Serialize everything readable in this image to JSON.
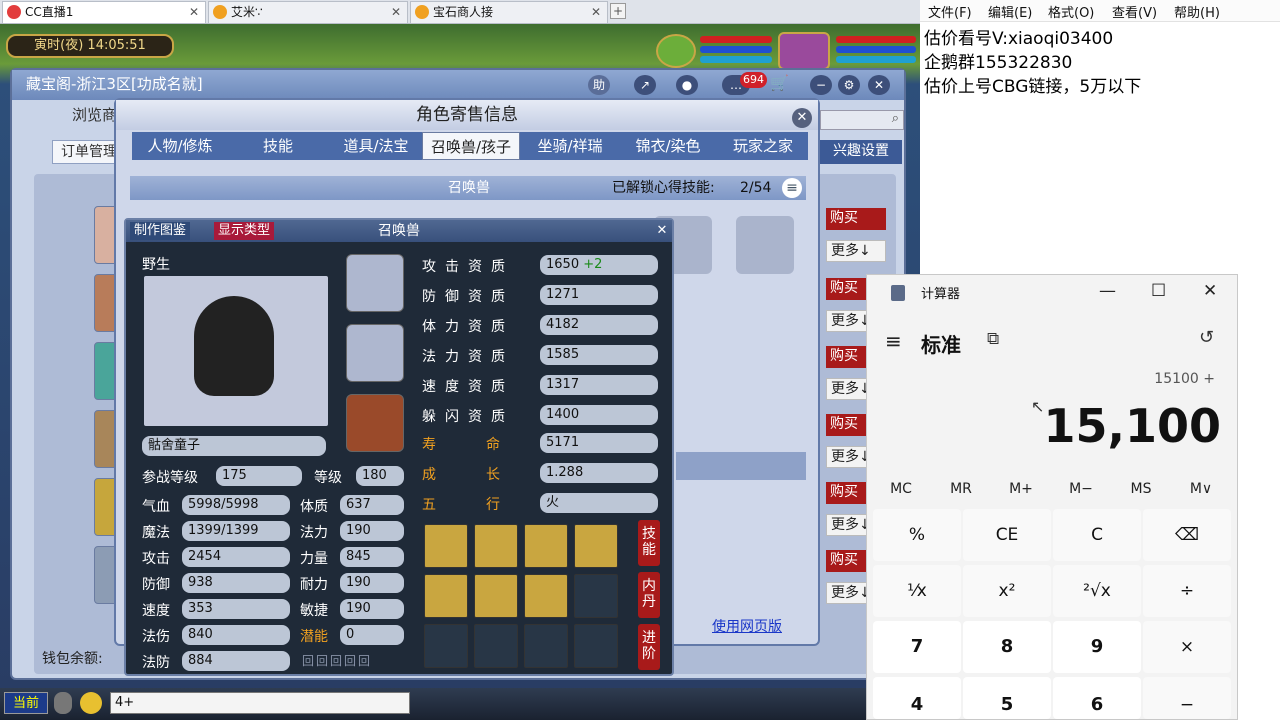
{
  "browser": {
    "tabs": [
      {
        "label": "CC直播1"
      },
      {
        "label": "艾米∵"
      },
      {
        "label": "宝石商人接"
      }
    ],
    "new_tab": "+"
  },
  "game": {
    "time": "寅时(夜)  14:05:51",
    "main_window": {
      "title": "藏宝阁-浙江3区[功成名就]",
      "help": "助",
      "badge": "694",
      "browse": "浏览商",
      "order": "订单管理",
      "hobby": "兴趣设置",
      "row_buy": "购买",
      "row_more": "更多↓",
      "wallet": "钱包余额:",
      "web_version": "使用网页版"
    },
    "role_dialog": {
      "title": "角色寄售信息",
      "tabs": [
        "人物/修炼",
        "技能",
        "道具/法宝",
        "召唤兽/孩子",
        "坐骑/祥瑞",
        "锦衣/染色",
        "玩家之家"
      ],
      "summon_header": "召唤兽",
      "unlock_label": "已解锁心得技能:",
      "unlock_value": "2/54"
    },
    "pet_card": {
      "chip_guide": "制作图鉴",
      "chip_type": "显示类型",
      "title": "召唤兽",
      "wild": "野生",
      "name": "骷舍童子",
      "battle_level_label": "参战等级",
      "battle_level": "175",
      "level_label": "等级",
      "level": "180",
      "stats": [
        {
          "label": "气血",
          "value": "5998/5998"
        },
        {
          "label": "魔法",
          "value": "1399/1399"
        },
        {
          "label": "攻击",
          "value": "2454"
        },
        {
          "label": "防御",
          "value": "938"
        },
        {
          "label": "速度",
          "value": "353"
        },
        {
          "label": "法伤",
          "value": "840"
        },
        {
          "label": "法防",
          "value": "884"
        }
      ],
      "attrs": [
        {
          "label": "体质",
          "value": "637"
        },
        {
          "label": "法力",
          "value": "190"
        },
        {
          "label": "力量",
          "value": "845"
        },
        {
          "label": "耐力",
          "value": "190"
        },
        {
          "label": "敏捷",
          "value": "190"
        },
        {
          "label": "潜能",
          "value": "0"
        }
      ],
      "quals": [
        {
          "label": "攻击资质",
          "value": "1650",
          "bonus": "+2"
        },
        {
          "label": "防御资质",
          "value": "1271"
        },
        {
          "label": "体力资质",
          "value": "4182"
        },
        {
          "label": "法力资质",
          "value": "1585"
        },
        {
          "label": "速度资质",
          "value": "1317"
        },
        {
          "label": "躲闪资质",
          "value": "1400"
        }
      ],
      "life_label": "寿命",
      "life": "5171",
      "growth_label": "成长",
      "growth": "1.288",
      "element_label": "五行",
      "element": "火",
      "side_buttons": [
        "技能",
        "内丹",
        "进阶"
      ]
    },
    "taskbar": {
      "current": "当前",
      "input": "4+"
    }
  },
  "notepad": {
    "menu": [
      "文件(F)",
      "编辑(E)",
      "格式(O)",
      "查看(V)",
      "帮助(H)"
    ],
    "lines": [
      "估价看号V:xiaoqi03400",
      "企鹅群155322830",
      "估价上号CBG链接，5万以下"
    ]
  },
  "calculator": {
    "title": "计算器",
    "mode": "标准",
    "expression": "15100 +",
    "display": "15,100",
    "memory": [
      "MC",
      "MR",
      "M+",
      "M−",
      "MS",
      "M∨"
    ],
    "keys": [
      [
        "%",
        "CE",
        "C",
        "⌫"
      ],
      [
        "¹⁄x",
        "x²",
        "²√x",
        "÷"
      ],
      [
        "7",
        "8",
        "9",
        "×"
      ],
      [
        "4",
        "5",
        "6",
        "−"
      ]
    ],
    "win_min": "—",
    "win_max": "☐",
    "win_close": "✕"
  }
}
